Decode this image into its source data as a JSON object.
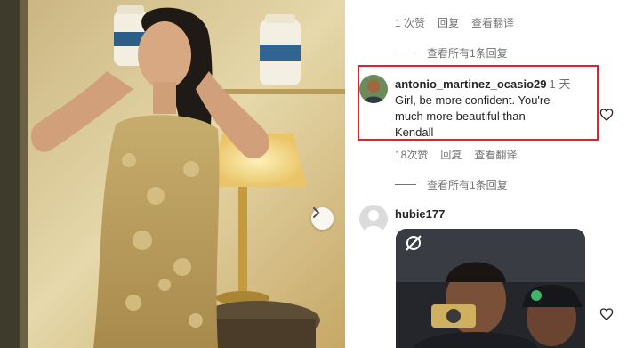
{
  "top_comment_meta": {
    "likes": "1 次赞",
    "reply": "回复",
    "translate": "查看翻译"
  },
  "top_view_replies": "查看所有1条回复",
  "highlighted_comment": {
    "username": "antonio_martinez_ocasio29",
    "time": "1 天",
    "text_line1": "Girl, be more confident. You're",
    "text_line2": "much more beautiful than",
    "text_line3": "Kendall",
    "likes": "18次赞",
    "reply": "回复",
    "translate": "查看翻译"
  },
  "second_view_replies": "查看所有1条回复",
  "gif_comment": {
    "username": "hubie177"
  },
  "icons": {
    "next": "chevron-right-icon",
    "like": "heart-outline-icon",
    "default_avatar": "default-user-avatar-icon"
  },
  "colors": {
    "highlight_border": "#d7262f",
    "secondary_text": "#737373",
    "primary_text": "#262626"
  }
}
